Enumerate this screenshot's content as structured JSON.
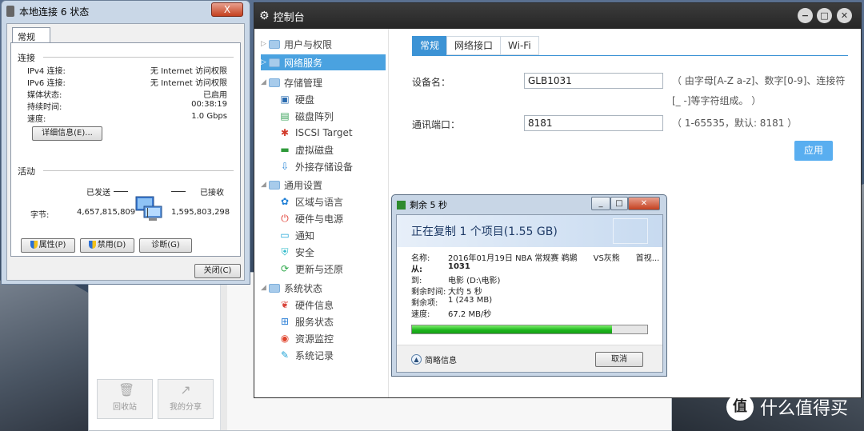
{
  "status": {
    "title": "本地连接 6 状态",
    "close": "X",
    "tab": "常规",
    "conn_section": "连接",
    "rows": [
      {
        "label": "IPv4 连接:",
        "value": "无 Internet 访问权限"
      },
      {
        "label": "IPv6 连接:",
        "value": "无 Internet 访问权限"
      },
      {
        "label": "媒体状态:",
        "value": "已启用"
      },
      {
        "label": "持续时间:",
        "value": "00:38:19"
      },
      {
        "label": "速度:",
        "value": "1.0 Gbps"
      }
    ],
    "details_btn": "详细信息(E)...",
    "activity_section": "活动",
    "sent": "已发送",
    "recv": "已接收",
    "bytes_label": "字节:",
    "bytes_sent": "4,657,815,809",
    "bytes_recv": "1,595,803,298",
    "prop_btn": "属性(P)",
    "disable_btn": "禁用(D)",
    "diag_btn": "诊断(G)",
    "close_btn": "关闭(C)"
  },
  "back": {
    "recycle": "回收站",
    "share": "我的分享"
  },
  "control": {
    "title": "控制台",
    "nav": [
      {
        "label": "用户与权限",
        "type": "group",
        "expanded": false
      },
      {
        "label": "网络服务",
        "type": "group",
        "selected": true,
        "expanded": false
      },
      {
        "label": "存储管理",
        "type": "group",
        "expanded": true
      },
      {
        "label": "硬盘",
        "type": "item",
        "icon": "disk-icon"
      },
      {
        "label": "磁盘阵列",
        "type": "item",
        "icon": "raid-icon"
      },
      {
        "label": "ISCSI Target",
        "type": "item",
        "icon": "iscsi-icon"
      },
      {
        "label": "虚拟磁盘",
        "type": "item",
        "icon": "virtual-disk-icon"
      },
      {
        "label": "外接存储设备",
        "type": "item",
        "icon": "usb-icon"
      },
      {
        "label": "通用设置",
        "type": "group",
        "expanded": true
      },
      {
        "label": "区域与语言",
        "type": "item",
        "icon": "region-icon"
      },
      {
        "label": "硬件与电源",
        "type": "item",
        "icon": "power-icon"
      },
      {
        "label": "通知",
        "type": "item",
        "icon": "notify-icon"
      },
      {
        "label": "安全",
        "type": "item",
        "icon": "security-icon"
      },
      {
        "label": "更新与还原",
        "type": "item",
        "icon": "update-icon"
      },
      {
        "label": "系统状态",
        "type": "group",
        "expanded": true
      },
      {
        "label": "硬件信息",
        "type": "item",
        "icon": "hardware-icon"
      },
      {
        "label": "服务状态",
        "type": "item",
        "icon": "service-icon"
      },
      {
        "label": "资源监控",
        "type": "item",
        "icon": "monitor-icon"
      },
      {
        "label": "系统记录",
        "type": "item",
        "icon": "log-icon"
      }
    ],
    "tabs": [
      "常规",
      "网络接口",
      "Wi-Fi"
    ],
    "device_label": "设备名：",
    "device_value": "GLB1031",
    "device_hint1": "（ 由字母[A-Z a-z]、数字[0-9]、连接符",
    "device_hint2": "[_ -]等字符组成。 ）",
    "port_label": "通讯端口：",
    "port_value": "8181",
    "port_hint": "（ 1-65535，默认: 8181 ）",
    "apply": "应用"
  },
  "copy": {
    "title": "剩余 5 秒",
    "heading": "正在复制 1 个项目(1.55 GB)",
    "rows": [
      {
        "k": "名称:",
        "v": "2016年01月19日 NBA 常规赛 鹈鹕　　VS灰熊　　首视..."
      },
      {
        "k": "从:",
        "v": "1031"
      },
      {
        "k": "到:",
        "v": "电影 (D:\\电影)"
      },
      {
        "k": "剩余时间:",
        "v": "大约 5 秒"
      },
      {
        "k": "剩余项:",
        "v": "1 (243 MB)"
      },
      {
        "k": "速度:",
        "v": "67.2 MB/秒"
      }
    ],
    "progress": 0.85,
    "more": "简略信息",
    "cancel": "取消"
  },
  "watermark": {
    "logo": "值",
    "text": "什么值得买"
  }
}
